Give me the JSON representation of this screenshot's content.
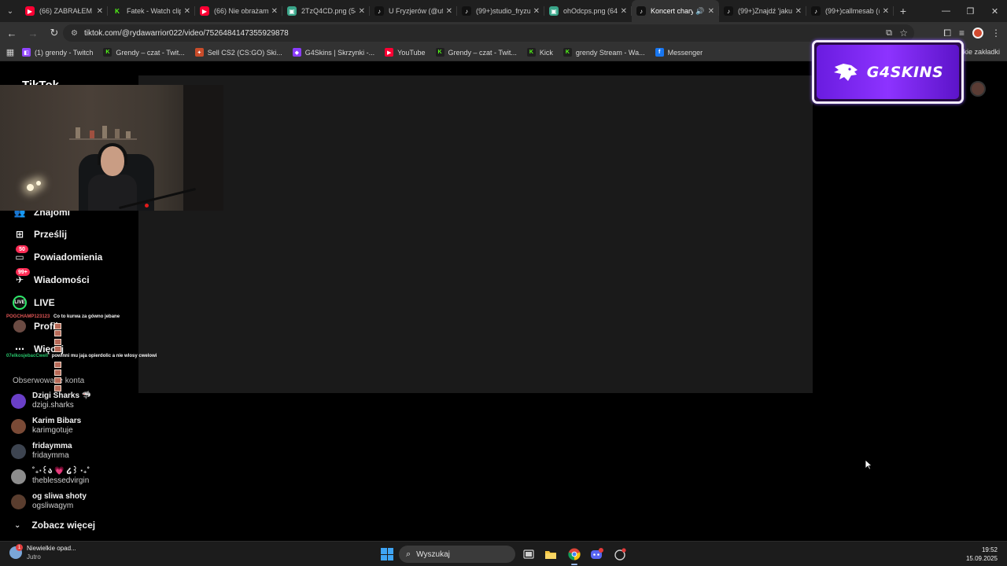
{
  "browser": {
    "tabs": [
      {
        "title": "(66) ZABRAŁEM JE",
        "favicon": "youtube",
        "active": false
      },
      {
        "title": "Fatek - Watch clip",
        "favicon": "kick",
        "active": false
      },
      {
        "title": "(66) Nie obrażam",
        "favicon": "youtube",
        "active": false
      },
      {
        "title": "2TzQ4CD.png (54",
        "favicon": "image",
        "active": false
      },
      {
        "title": "U Fryzjerów (@ufr",
        "favicon": "tiktok",
        "active": false
      },
      {
        "title": "(99+)studio_fryzu",
        "favicon": "tiktok",
        "active": false
      },
      {
        "title": "ohOdcps.png (64",
        "favicon": "image",
        "active": false
      },
      {
        "title": "Koncert chary",
        "favicon": "tiktok",
        "active": true,
        "audio": true
      },
      {
        "title": "(99+)Znajdź 'jaku",
        "favicon": "tiktok",
        "active": false
      },
      {
        "title": "(99+)callmesab (@",
        "favicon": "tiktok",
        "active": false
      }
    ],
    "url": "tiktok.com/@rydawarrior022/video/7526484147355929878",
    "bookmarks": [
      {
        "label": "(1) grendy - Twitch",
        "favicon": "twitch"
      },
      {
        "label": "Grendy – czat - Twit...",
        "favicon": "kick"
      },
      {
        "label": "Sell CS2 (CS:GO) Ski...",
        "favicon": "skin"
      },
      {
        "label": "G4Skins | Skrzynki -...",
        "favicon": "g4"
      },
      {
        "label": "YouTube",
        "favicon": "youtube"
      },
      {
        "label": "Grendy – czat - Twit...",
        "favicon": "kick"
      },
      {
        "label": "Kick",
        "favicon": "kick"
      },
      {
        "label": "grendy Stream - Wa...",
        "favicon": "kick"
      },
      {
        "label": "Messenger",
        "favicon": "facebook"
      }
    ],
    "bookmarks_right": "tkie zakładki"
  },
  "page": {
    "logo": "TikTok",
    "sidebar": {
      "items": [
        {
          "label": "Znajomi",
          "icon": "friends-icon"
        },
        {
          "label": "Prześlij",
          "icon": "upload-icon"
        },
        {
          "label": "Powiadomienia",
          "icon": "inbox-icon",
          "badge": "50"
        },
        {
          "label": "Wiadomości",
          "icon": "messages-icon",
          "badge": "99+"
        },
        {
          "label": "LIVE",
          "icon": "live-icon"
        },
        {
          "label": "Profil",
          "icon": "profile-icon"
        },
        {
          "label": "Więcej",
          "icon": "more-icon"
        }
      ],
      "followed_title": "Obserwowane konta",
      "accounts": [
        {
          "name": "Dzigi Sharks 🦈",
          "username": "dzigi.sharks",
          "color": "#6a3fc7"
        },
        {
          "name": "Karim Bibars",
          "username": "karimgotuje",
          "color": "#7a4a36"
        },
        {
          "name": "fridaymma",
          "username": "fridaymma",
          "color": "#3d4450"
        },
        {
          "name": "˚₊‧꒰ა 💗 ໒꒱ ‧₊˚",
          "username": "theblessedvirgin",
          "color": "#8d8d8d"
        },
        {
          "name": "og sliwa shoty",
          "username": "ogsliwagym",
          "color": "#5a3d2e"
        }
      ],
      "see_more": "Zobacz więcej"
    }
  },
  "overlay": {
    "chat": [
      {
        "user": "POGCHAMP123123",
        "message": "Co to kurwa za gówno jebane",
        "color": "#e05555"
      },
      {
        "user": "07elkosjebacCwell",
        "message": "powinni mu jaja opierdolic a nie wlosy cwelowi",
        "color": "#27c26a"
      }
    ],
    "sponsor": "G4SKINS"
  },
  "taskbar": {
    "weather_line1": "Niewielkie opad...",
    "weather_line2": "Jutro",
    "weather_badge": "1",
    "search_placeholder": "Wyszukaj",
    "time": "19:52",
    "date": "15.09.2025"
  }
}
